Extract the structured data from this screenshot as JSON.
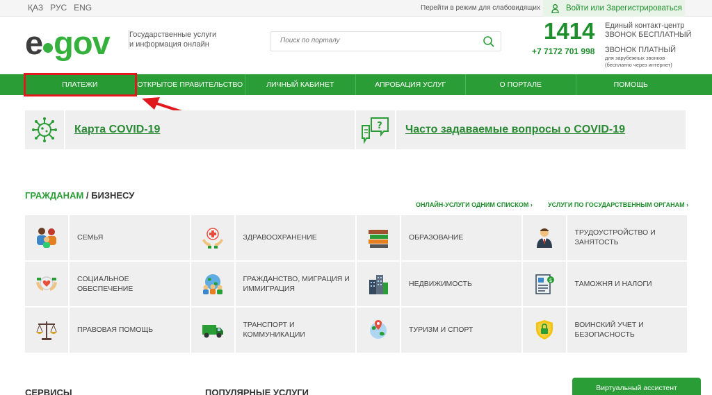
{
  "topbar": {
    "languages": [
      "ҚАЗ",
      "РУС",
      "ENG"
    ],
    "impaired_mode": "Перейти в режим для слабовидящих",
    "login": "Войти или Зарегистрироваться"
  },
  "header": {
    "logo_e": "e",
    "logo_gov": "gov",
    "tagline_line1": "Государственные услуги",
    "tagline_line2": "и информация онлайн",
    "search_placeholder": "Поиск по порталу",
    "hotline": "1414",
    "hotline_desc1": "Единый контакт-центр",
    "hotline_desc2": "ЗВОНОК БЕСПЛАТНЫЙ",
    "phone": "+7 7172 701 998",
    "phone_desc1": "ЗВОНОК ПЛАТНЫЙ",
    "phone_desc2": "для зарубежных звонков",
    "phone_desc3": "(бесплатно через интернет)"
  },
  "nav": {
    "items": [
      "ПЛАТЕЖИ",
      "ОТКРЫТОЕ ПРАВИТЕЛЬСТВО",
      "ЛИЧНЫЙ КАБИНЕТ",
      "АПРОБАЦИЯ УСЛУГ",
      "О ПОРТАЛЕ",
      "ПОМОЩЬ"
    ]
  },
  "covid": {
    "map": "Карта COVID-19",
    "faq": "Часто задаваемые вопросы о COVID-19"
  },
  "section": {
    "title_citizens": "ГРАЖДАНАМ",
    "title_sep": " / ",
    "title_business": "БИЗНЕСУ",
    "link_online": "ОНЛАЙН-УСЛУГИ ОДНИМ СПИСКОМ ›",
    "link_agencies": "УСЛУГИ ПО ГОСУДАРСТВЕННЫМ ОРГАНАМ ›"
  },
  "categories": [
    "СЕМЬЯ",
    "ЗДРАВООХРАНЕНИЕ",
    "ОБРАЗОВАНИЕ",
    "ТРУДОУСТРОЙСТВО И\nЗАНЯТОСТЬ",
    "СОЦИАЛЬНОЕ\nОБЕСПЕЧЕНИЕ",
    "ГРАЖДАНСТВО, МИГРАЦИЯ И\nИММИГРАЦИЯ",
    "НЕДВИЖИМОСТЬ",
    "ТАМОЖНЯ И НАЛОГИ",
    "ПРАВОВАЯ ПОМОЩЬ",
    "ТРАНСПОРТ И\nКОММУНИКАЦИИ",
    "ТУРИЗМ И СПОРТ",
    "ВОИНСКИЙ УЧЕТ И\nБЕЗОПАСНОСТЬ"
  ],
  "bottom": {
    "services": "СЕРВИСЫ",
    "popular": "ПОПУЛЯРНЫЕ УСЛУГИ",
    "assistant": "Виртуальный ассистент"
  },
  "colors": {
    "brand_green": "#2a9d36",
    "highlight_red": "#e0191f"
  }
}
